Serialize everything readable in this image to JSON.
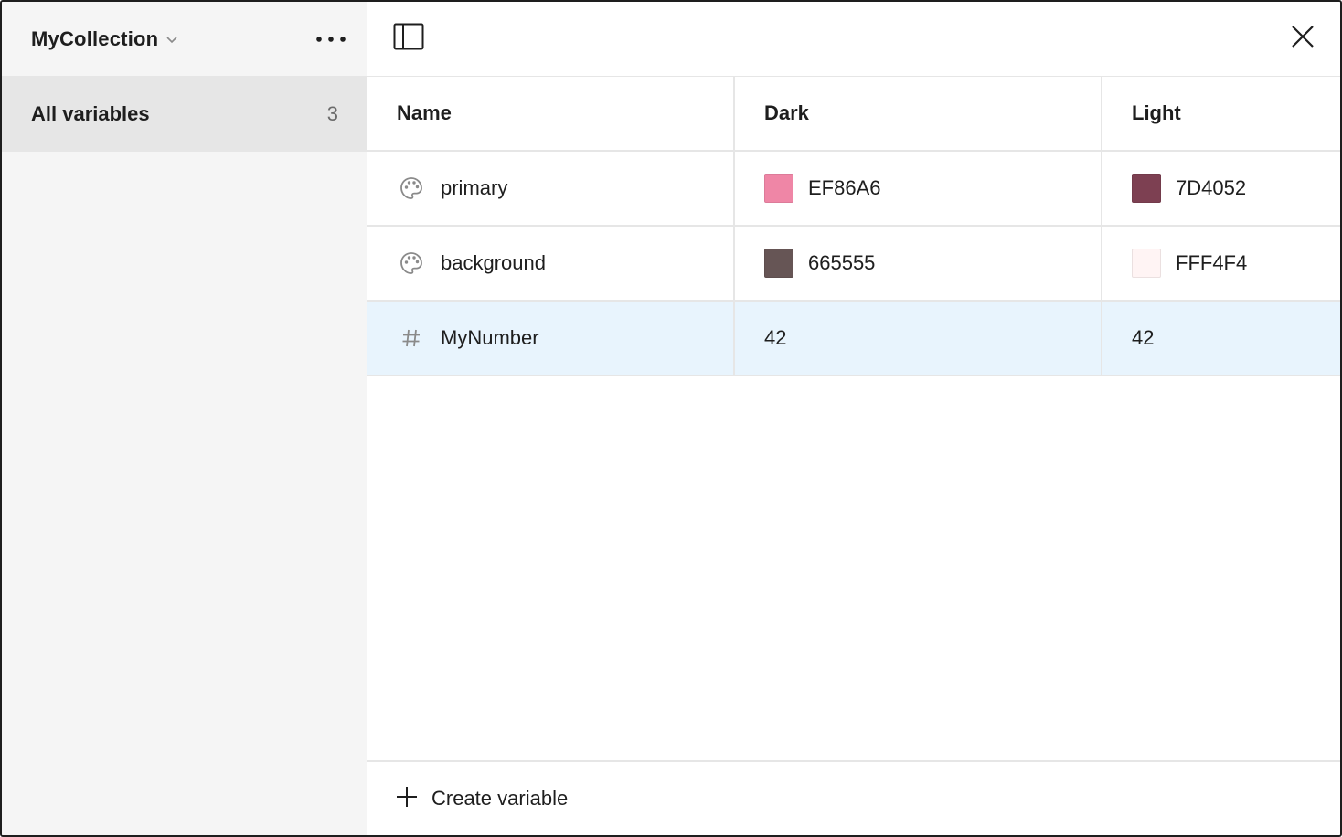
{
  "sidebar": {
    "collection_name": "MyCollection",
    "items": [
      {
        "label": "All variables",
        "count": "3"
      }
    ]
  },
  "table": {
    "headers": {
      "name": "Name",
      "dark": "Dark",
      "light": "Light"
    },
    "rows": [
      {
        "type": "color",
        "icon": "palette-icon",
        "name": "primary",
        "dark": {
          "value": "EF86A6",
          "color": "#EF86A6"
        },
        "light": {
          "value": "7D4052",
          "color": "#7D4052"
        }
      },
      {
        "type": "color",
        "icon": "palette-icon",
        "name": "background",
        "dark": {
          "value": "665555",
          "color": "#665555"
        },
        "light": {
          "value": "FFF4F4",
          "color": "#FFF4F4"
        }
      },
      {
        "type": "number",
        "icon": "hash-icon",
        "name": "MyNumber",
        "dark": {
          "value": "42"
        },
        "light": {
          "value": "42"
        },
        "selected": true
      }
    ]
  },
  "footer": {
    "create_label": "Create variable"
  },
  "colors": {
    "selected_row": "#e8f4fd",
    "sidebar_bg": "#f5f5f5",
    "sidebar_selected": "#e6e6e6"
  }
}
